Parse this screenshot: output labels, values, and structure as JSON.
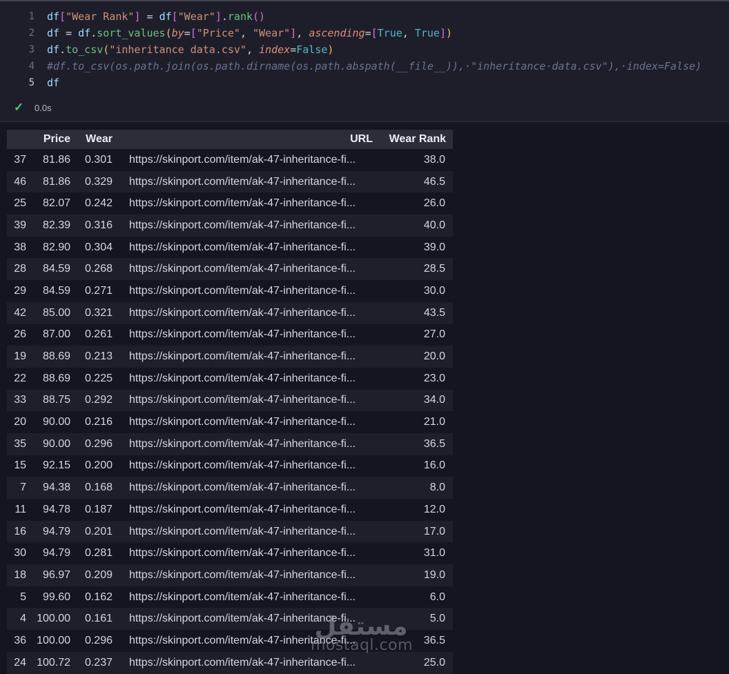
{
  "editor": {
    "active_line": 5,
    "lines": [
      {
        "num": "1",
        "tokens": [
          {
            "t": "df",
            "c": "id"
          },
          {
            "t": "[",
            "c": "bp"
          },
          {
            "t": "\"Wear Rank\"",
            "c": "str"
          },
          {
            "t": "]",
            "c": "bp"
          },
          {
            "t": " = ",
            "c": "pn"
          },
          {
            "t": "df",
            "c": "id"
          },
          {
            "t": "[",
            "c": "bp"
          },
          {
            "t": "\"Wear\"",
            "c": "str"
          },
          {
            "t": "]",
            "c": "bp"
          },
          {
            "t": ".",
            "c": "pn"
          },
          {
            "t": "rank",
            "c": "fn"
          },
          {
            "t": "()",
            "c": "bp"
          }
        ]
      },
      {
        "num": "2",
        "tokens": [
          {
            "t": "df",
            "c": "id"
          },
          {
            "t": " = ",
            "c": "pn"
          },
          {
            "t": "df",
            "c": "id"
          },
          {
            "t": ".",
            "c": "pn"
          },
          {
            "t": "sort_values",
            "c": "fn"
          },
          {
            "t": "(",
            "c": "bg"
          },
          {
            "t": "by",
            "c": "kwa"
          },
          {
            "t": "=",
            "c": "pn"
          },
          {
            "t": "[",
            "c": "bp"
          },
          {
            "t": "\"Price\"",
            "c": "str"
          },
          {
            "t": ", ",
            "c": "pn"
          },
          {
            "t": "\"Wear\"",
            "c": "str"
          },
          {
            "t": "]",
            "c": "bp"
          },
          {
            "t": ", ",
            "c": "pn"
          },
          {
            "t": "ascending",
            "c": "kwa"
          },
          {
            "t": "=",
            "c": "pn"
          },
          {
            "t": "[",
            "c": "bp"
          },
          {
            "t": "True",
            "c": "bool"
          },
          {
            "t": ", ",
            "c": "pn"
          },
          {
            "t": "True",
            "c": "bool"
          },
          {
            "t": "]",
            "c": "bp"
          },
          {
            "t": ")",
            "c": "bg"
          }
        ]
      },
      {
        "num": "3",
        "tokens": [
          {
            "t": "df",
            "c": "id"
          },
          {
            "t": ".",
            "c": "pn"
          },
          {
            "t": "to_csv",
            "c": "fn"
          },
          {
            "t": "(",
            "c": "bg"
          },
          {
            "t": "\"inheritance data.csv\"",
            "c": "str"
          },
          {
            "t": ", ",
            "c": "pn"
          },
          {
            "t": "index",
            "c": "kwa"
          },
          {
            "t": "=",
            "c": "pn"
          },
          {
            "t": "False",
            "c": "bool"
          },
          {
            "t": ")",
            "c": "bg"
          }
        ]
      },
      {
        "num": "4",
        "tokens": [
          {
            "t": "#df.to_csv(os.path.join(os.path.dirname(os.path.abspath(__file__)),·\"inheritance·data.csv\"),·index=False)",
            "c": "cm"
          }
        ]
      },
      {
        "num": "5",
        "tokens": [
          {
            "t": "df",
            "c": "id"
          }
        ]
      }
    ],
    "status": {
      "check": "✓",
      "time": "0.0s"
    }
  },
  "table": {
    "headers": {
      "index": "",
      "price": "Price",
      "wear": "Wear",
      "url": "URL",
      "rank": "Wear Rank"
    },
    "rows": [
      {
        "index": "37",
        "price": "81.86",
        "wear": "0.301",
        "url": "https://skinport.com/item/ak-47-inheritance-fi...",
        "rank": "38.0"
      },
      {
        "index": "46",
        "price": "81.86",
        "wear": "0.329",
        "url": "https://skinport.com/item/ak-47-inheritance-fi...",
        "rank": "46.5"
      },
      {
        "index": "25",
        "price": "82.07",
        "wear": "0.242",
        "url": "https://skinport.com/item/ak-47-inheritance-fi...",
        "rank": "26.0"
      },
      {
        "index": "39",
        "price": "82.39",
        "wear": "0.316",
        "url": "https://skinport.com/item/ak-47-inheritance-fi...",
        "rank": "40.0"
      },
      {
        "index": "38",
        "price": "82.90",
        "wear": "0.304",
        "url": "https://skinport.com/item/ak-47-inheritance-fi...",
        "rank": "39.0"
      },
      {
        "index": "28",
        "price": "84.59",
        "wear": "0.268",
        "url": "https://skinport.com/item/ak-47-inheritance-fi...",
        "rank": "28.5"
      },
      {
        "index": "29",
        "price": "84.59",
        "wear": "0.271",
        "url": "https://skinport.com/item/ak-47-inheritance-fi...",
        "rank": "30.0"
      },
      {
        "index": "42",
        "price": "85.00",
        "wear": "0.321",
        "url": "https://skinport.com/item/ak-47-inheritance-fi...",
        "rank": "43.5"
      },
      {
        "index": "26",
        "price": "87.00",
        "wear": "0.261",
        "url": "https://skinport.com/item/ak-47-inheritance-fi...",
        "rank": "27.0"
      },
      {
        "index": "19",
        "price": "88.69",
        "wear": "0.213",
        "url": "https://skinport.com/item/ak-47-inheritance-fi...",
        "rank": "20.0"
      },
      {
        "index": "22",
        "price": "88.69",
        "wear": "0.225",
        "url": "https://skinport.com/item/ak-47-inheritance-fi...",
        "rank": "23.0"
      },
      {
        "index": "33",
        "price": "88.75",
        "wear": "0.292",
        "url": "https://skinport.com/item/ak-47-inheritance-fi...",
        "rank": "34.0"
      },
      {
        "index": "20",
        "price": "90.00",
        "wear": "0.216",
        "url": "https://skinport.com/item/ak-47-inheritance-fi...",
        "rank": "21.0"
      },
      {
        "index": "35",
        "price": "90.00",
        "wear": "0.296",
        "url": "https://skinport.com/item/ak-47-inheritance-fi...",
        "rank": "36.5"
      },
      {
        "index": "15",
        "price": "92.15",
        "wear": "0.200",
        "url": "https://skinport.com/item/ak-47-inheritance-fi...",
        "rank": "16.0"
      },
      {
        "index": "7",
        "price": "94.38",
        "wear": "0.168",
        "url": "https://skinport.com/item/ak-47-inheritance-fi...",
        "rank": "8.0"
      },
      {
        "index": "11",
        "price": "94.78",
        "wear": "0.187",
        "url": "https://skinport.com/item/ak-47-inheritance-fi...",
        "rank": "12.0"
      },
      {
        "index": "16",
        "price": "94.79",
        "wear": "0.201",
        "url": "https://skinport.com/item/ak-47-inheritance-fi...",
        "rank": "17.0"
      },
      {
        "index": "30",
        "price": "94.79",
        "wear": "0.281",
        "url": "https://skinport.com/item/ak-47-inheritance-fi...",
        "rank": "31.0"
      },
      {
        "index": "18",
        "price": "96.97",
        "wear": "0.209",
        "url": "https://skinport.com/item/ak-47-inheritance-fi...",
        "rank": "19.0"
      },
      {
        "index": "5",
        "price": "99.60",
        "wear": "0.162",
        "url": "https://skinport.com/item/ak-47-inheritance-fi...",
        "rank": "6.0"
      },
      {
        "index": "4",
        "price": "100.00",
        "wear": "0.161",
        "url": "https://skinport.com/item/ak-47-inheritance-fi...",
        "rank": "5.0"
      },
      {
        "index": "36",
        "price": "100.00",
        "wear": "0.296",
        "url": "https://skinport.com/item/ak-47-inheritance-fi...",
        "rank": "36.5"
      },
      {
        "index": "24",
        "price": "100.72",
        "wear": "0.237",
        "url": "https://skinport.com/item/ak-47-inheritance-fi...",
        "rank": "25.0"
      }
    ]
  },
  "watermark": {
    "arabic": "مستقل",
    "latin": "mostaql.com"
  },
  "colors": {
    "page_bg": "#15151f",
    "cell_bg": "#1e1e2b",
    "header_bg": "#2d2d38",
    "stripe_bg": "#1f1f2a",
    "check_green": "#58c470",
    "string": "#ce9178",
    "function": "#6fbf7f",
    "bracket_gold": "#e2c06c",
    "bracket_pink": "#d670d6"
  }
}
